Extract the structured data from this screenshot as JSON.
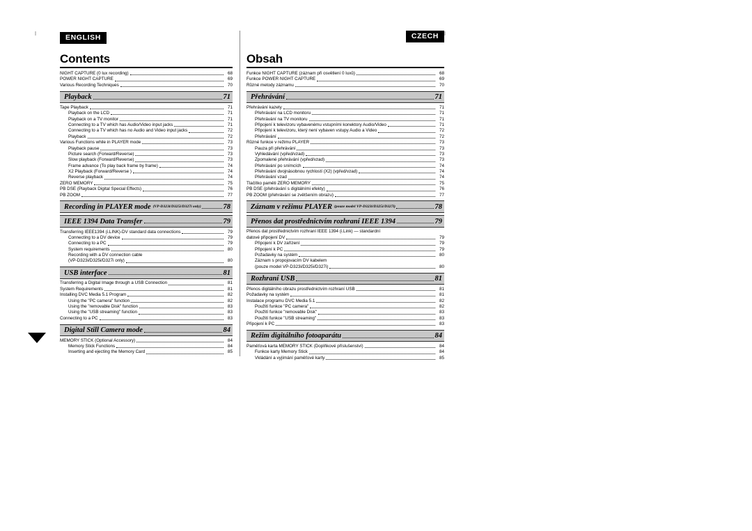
{
  "document": {
    "page_marker": "4"
  },
  "english": {
    "lang_tag": "ENGLISH",
    "title": "Contents",
    "entries": [
      {
        "kind": "item",
        "level": 1,
        "text": "NIGHT CAPTURE (0 lux recording)",
        "page": "68"
      },
      {
        "kind": "item",
        "level": 1,
        "text": "POWER NIGHT CAPTURE",
        "page": "69"
      },
      {
        "kind": "item",
        "level": 1,
        "text": "Various Recording Techniques",
        "page": "70"
      },
      {
        "kind": "section",
        "title": "Playback",
        "note": "",
        "page": "71"
      },
      {
        "kind": "item",
        "level": 1,
        "text": "Tape Playback",
        "page": "71"
      },
      {
        "kind": "item",
        "level": 2,
        "text": "Playback on the LCD",
        "page": "71"
      },
      {
        "kind": "item",
        "level": 2,
        "text": "Playback on a TV monitor",
        "page": "71"
      },
      {
        "kind": "item",
        "level": 2,
        "text": "Connecting to a TV which has Audio/Video input jacks",
        "page": "71"
      },
      {
        "kind": "item",
        "level": 2,
        "text": "Connecting to a TV which has no Audio and Video input jacks",
        "page": "72"
      },
      {
        "kind": "item",
        "level": 2,
        "text": "Playback",
        "page": "72"
      },
      {
        "kind": "item",
        "level": 1,
        "text": "Various Functions while in PLAYER mode",
        "page": "73"
      },
      {
        "kind": "item",
        "level": 2,
        "text": "Playback pause",
        "page": "73"
      },
      {
        "kind": "item",
        "level": 2,
        "text": "Picture search (Forward/Reverse)",
        "page": "73"
      },
      {
        "kind": "item",
        "level": 2,
        "text": "Slow playback (Forward/Reverse)",
        "page": "73"
      },
      {
        "kind": "item",
        "level": 2,
        "text": "Frame advance (To play back frame by frame)",
        "page": "74"
      },
      {
        "kind": "item",
        "level": 2,
        "text": "X2 Playback (Forward/Reverse )",
        "page": "74"
      },
      {
        "kind": "item",
        "level": 2,
        "text": "Reverse playback",
        "page": "74"
      },
      {
        "kind": "item",
        "level": 1,
        "text": "ZERO MEMORY",
        "page": "75"
      },
      {
        "kind": "item",
        "level": 1,
        "text": "PB DSE (Playback Digital Special Effects)",
        "page": "76"
      },
      {
        "kind": "item",
        "level": 1,
        "text": "PB ZOOM",
        "page": "77"
      },
      {
        "kind": "section",
        "title": "Recording in PLAYER mode",
        "note": "(VP-D323i/D325i/D327i only)",
        "page": "78"
      },
      {
        "kind": "section",
        "title": "IEEE 1394 Data Transfer",
        "note": "",
        "page": "79"
      },
      {
        "kind": "item",
        "level": 1,
        "text": "Transferring IEEE1394 (i.LINK)-DV standard data connections",
        "page": "79"
      },
      {
        "kind": "item",
        "level": 2,
        "text": "Connecting to a DV device",
        "page": "79"
      },
      {
        "kind": "item",
        "level": 2,
        "text": "Connecting to a PC",
        "page": "79"
      },
      {
        "kind": "item",
        "level": 2,
        "text": "System requirements",
        "page": "80"
      },
      {
        "kind": "cont",
        "level": 2,
        "text": "Recording with a DV connection cable"
      },
      {
        "kind": "item",
        "level": 2,
        "text": "(VP-D323i/D325i/D327i only)",
        "page": "80"
      },
      {
        "kind": "section",
        "title": "USB interface",
        "note": "",
        "page": "81"
      },
      {
        "kind": "item",
        "level": 1,
        "text": "Transferring a Digital Image through a USB Connection",
        "page": "81"
      },
      {
        "kind": "item",
        "level": 1,
        "text": "System Requirements",
        "page": "81"
      },
      {
        "kind": "item",
        "level": 1,
        "text": "Installing DVC Media 5.1 Program",
        "page": "82"
      },
      {
        "kind": "item",
        "level": 2,
        "text": "Using the \"PC camera\" function",
        "page": "82"
      },
      {
        "kind": "item",
        "level": 2,
        "text": "Using the \"removable Disk\" function",
        "page": "83"
      },
      {
        "kind": "item",
        "level": 2,
        "text": "Using the \"USB streaming\" function",
        "page": "83"
      },
      {
        "kind": "item",
        "level": 1,
        "text": "Connecting to a PC",
        "page": "83"
      },
      {
        "kind": "section",
        "title": "Digital Still Camera mode",
        "note": "",
        "page": "84"
      },
      {
        "kind": "item",
        "level": 1,
        "text": "MEMORY STICK (Optional Accessory)",
        "page": "84"
      },
      {
        "kind": "item",
        "level": 2,
        "text": "Memory Stick Functions",
        "page": "84"
      },
      {
        "kind": "item",
        "level": 2,
        "text": "Inserting and ejecting the Memory Card",
        "page": "85"
      }
    ]
  },
  "czech": {
    "lang_tag": "CZECH",
    "title": "Obsah",
    "entries": [
      {
        "kind": "item",
        "level": 1,
        "text": "Funkce NIGHT CAPTURE (záznam při osvětlení 0 luxů)",
        "page": "68"
      },
      {
        "kind": "item",
        "level": 1,
        "text": "Funkce POWER NIGHT CAPTURE",
        "page": "69"
      },
      {
        "kind": "item",
        "level": 1,
        "text": "Různé metody záznamu",
        "page": "70"
      },
      {
        "kind": "section",
        "title": "Přehrávání",
        "note": "",
        "page": "71"
      },
      {
        "kind": "item",
        "level": 1,
        "text": "Přehrávání kazety",
        "page": "71"
      },
      {
        "kind": "item",
        "level": 2,
        "text": "Přehrávání na LCD monitoru",
        "page": "71"
      },
      {
        "kind": "item",
        "level": 2,
        "text": "Přehrávání na TV monitoru",
        "page": "71"
      },
      {
        "kind": "item",
        "level": 2,
        "text": "Připojení k televizoru vybavenému vstupními konektory Audio/Video",
        "page": "71"
      },
      {
        "kind": "item",
        "level": 2,
        "text": "Připojení k televizoru, který není vybaven vstupy Audio a Video",
        "page": "72"
      },
      {
        "kind": "item",
        "level": 2,
        "text": "Přehrávání",
        "page": "72"
      },
      {
        "kind": "item",
        "level": 1,
        "text": "Různé funkce v režimu PLAYER",
        "page": "73"
      },
      {
        "kind": "item",
        "level": 2,
        "text": "Pauza při přehrávání",
        "page": "73"
      },
      {
        "kind": "item",
        "level": 2,
        "text": "Vyhledávání (vpřed/vzad)",
        "page": "73"
      },
      {
        "kind": "item",
        "level": 2,
        "text": "Zpomalené přehrávání (vpřed/vzad)",
        "page": "73"
      },
      {
        "kind": "item",
        "level": 2,
        "text": "Přehrávání po snímcích",
        "page": "74"
      },
      {
        "kind": "item",
        "level": 2,
        "text": "Přehrávání dvojnásobnou rychlostí (X2) (vpřed/vzad)",
        "page": "74"
      },
      {
        "kind": "item",
        "level": 2,
        "text": "Přehrávání vzad",
        "page": "74"
      },
      {
        "kind": "item",
        "level": 1,
        "text": "Tlačítko paměti ZERO MEMORY",
        "page": "75"
      },
      {
        "kind": "item",
        "level": 1,
        "text": "PB DSE (přehrávání s digitálními efekty)",
        "page": "76"
      },
      {
        "kind": "item",
        "level": 1,
        "text": "PB ZOOM (přehrávání se zvětšením obrazu)",
        "page": "77"
      },
      {
        "kind": "section",
        "title": "Záznam v režimu PLAYER",
        "note": "(pouze model VP-D323i/D325i/D327i)",
        "page": "78"
      },
      {
        "kind": "section",
        "title": "Přenos dat prostřednictvím rozhraní IEEE 1394",
        "note": "",
        "page": "79"
      },
      {
        "kind": "cont",
        "level": 1,
        "text": "Přenos dat prostřednictvím rozhraní IEEE 1394 (i.Link) — standardní"
      },
      {
        "kind": "item",
        "level": 1,
        "text": "datové připojení DV",
        "page": "79"
      },
      {
        "kind": "item",
        "level": 2,
        "text": "Připojení k DV zařízení",
        "page": "79"
      },
      {
        "kind": "item",
        "level": 2,
        "text": "Připojení k PC",
        "page": "79"
      },
      {
        "kind": "item",
        "level": 2,
        "text": "Požadavky na systém",
        "page": "80"
      },
      {
        "kind": "cont",
        "level": 2,
        "text": "Záznam s propojovacím DV kabelem"
      },
      {
        "kind": "item",
        "level": 2,
        "text": "(pouze model VP-D323i/D325i/D327i)",
        "page": "80"
      },
      {
        "kind": "section",
        "title": "Rozhraní USB",
        "note": "",
        "page": "81"
      },
      {
        "kind": "item",
        "level": 1,
        "text": "Přenos digitálního obrazu prostřednictvím rozhraní USB",
        "page": "81"
      },
      {
        "kind": "item",
        "level": 1,
        "text": "Požadavky na systém",
        "page": "81"
      },
      {
        "kind": "item",
        "level": 1,
        "text": "Instalace programu DVC Media 5.1",
        "page": "82"
      },
      {
        "kind": "item",
        "level": 2,
        "text": "Použití funkce \"PC camera\"",
        "page": "82"
      },
      {
        "kind": "item",
        "level": 2,
        "text": "Použití funkce \"removable Disk\"",
        "page": "83"
      },
      {
        "kind": "item",
        "level": 2,
        "text": "Použití funkce \"USB streaming\"",
        "page": "83"
      },
      {
        "kind": "item",
        "level": 1,
        "text": "Připojení k PC",
        "page": "83"
      },
      {
        "kind": "section",
        "title": "Režim digitálního fotoaparátu",
        "note": "",
        "page": "84"
      },
      {
        "kind": "item",
        "level": 1,
        "text": "Paměťová karta MEMORY STICK (Doplňkové příslušenství)",
        "page": "84"
      },
      {
        "kind": "item",
        "level": 2,
        "text": "Funkce karty Memory Stick",
        "page": "84"
      },
      {
        "kind": "item",
        "level": 2,
        "text": "Vkládání a vyjímání paměťové karty",
        "page": "85"
      }
    ]
  }
}
